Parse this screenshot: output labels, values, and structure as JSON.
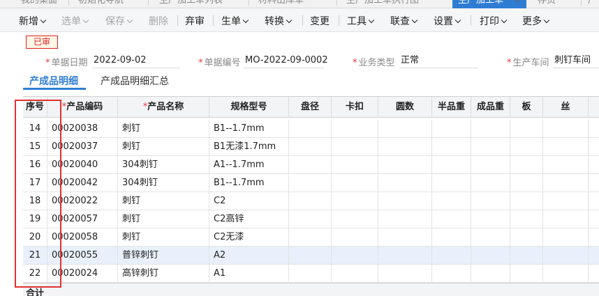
{
  "tabs": [
    {
      "label": "我的桌面",
      "active": false
    },
    {
      "label": "初始化导航",
      "active": false
    },
    {
      "label": "生产加工单列表",
      "active": false
    },
    {
      "label": "材料出库单 *",
      "active": false
    },
    {
      "label": "生产加工单执行图",
      "active": false
    },
    {
      "label": "生产加工单",
      "active": true
    },
    {
      "label": "存货",
      "active": false
    },
    {
      "label": "产",
      "active": false
    }
  ],
  "toolbar": [
    {
      "label": "新增",
      "caret": true,
      "disabled": false
    },
    {
      "label": "选单",
      "caret": true,
      "disabled": true
    },
    {
      "label": "保存",
      "caret": true,
      "disabled": true
    },
    {
      "label": "删除",
      "caret": false,
      "disabled": true
    },
    {
      "label": "弃审",
      "caret": false,
      "disabled": false
    },
    {
      "label": "生单",
      "caret": true,
      "disabled": false
    },
    {
      "label": "转换",
      "caret": true,
      "disabled": false
    },
    {
      "label": "变更",
      "caret": false,
      "disabled": false
    },
    {
      "label": "工具",
      "caret": true,
      "disabled": false
    },
    {
      "label": "联查",
      "caret": true,
      "disabled": false
    },
    {
      "label": "设置",
      "caret": true,
      "disabled": false
    },
    {
      "label": "打印",
      "caret": true,
      "disabled": false
    },
    {
      "label": "更多",
      "caret": true,
      "disabled": false
    }
  ],
  "status_badge": "已审",
  "form": {
    "date_label": "单据日期",
    "date_value": "2022-09-02",
    "code_label": "单据编号",
    "code_value": "MO-2022-09-0002",
    "biz_label": "业务类型",
    "biz_value": "正常",
    "workshop_label": "生产车间",
    "workshop_value": "刺钉车间"
  },
  "subtabs": {
    "detail": "产成品明细",
    "summary": "产成品明细汇总"
  },
  "grid": {
    "columns": [
      {
        "label": "序号",
        "required": false
      },
      {
        "label": "产品编码",
        "required": true
      },
      {
        "label": "产品名称",
        "required": true
      },
      {
        "label": "规格型号",
        "required": false
      },
      {
        "label": "盘径",
        "required": false
      },
      {
        "label": "卡扣",
        "required": false
      },
      {
        "label": "圆数",
        "required": false
      },
      {
        "label": "半品重",
        "required": false
      },
      {
        "label": "成品重",
        "required": false
      },
      {
        "label": "板",
        "required": false
      },
      {
        "label": "丝",
        "required": false
      }
    ],
    "rows": [
      {
        "seq": "14",
        "code": "00020038",
        "name": "刺钉",
        "spec": "B1--1.7mm"
      },
      {
        "seq": "15",
        "code": "00020037",
        "name": "刺钉",
        "spec": "B1无漆1.7mm"
      },
      {
        "seq": "16",
        "code": "00020040",
        "name": "304刺钉",
        "spec": "A1--1.7mm"
      },
      {
        "seq": "17",
        "code": "00020042",
        "name": "304刺钉",
        "spec": "B1--1.7mm"
      },
      {
        "seq": "18",
        "code": "00020022",
        "name": "刺钉",
        "spec": "C2"
      },
      {
        "seq": "19",
        "code": "00020057",
        "name": "刺钉",
        "spec": "C2高锌"
      },
      {
        "seq": "20",
        "code": "00020058",
        "name": "刺钉",
        "spec": "C2无漆"
      },
      {
        "seq": "21",
        "code": "00020055",
        "name": "普锌刺钉",
        "spec": "A2"
      },
      {
        "seq": "22",
        "code": "00020024",
        "name": "高锌刺钉",
        "spec": "A1"
      }
    ],
    "selected_row": "21",
    "footer": "合计"
  },
  "colors": {
    "accent": "#2f7dd3",
    "highlight": "#e03030",
    "selected_row": "#e8f1fb"
  }
}
